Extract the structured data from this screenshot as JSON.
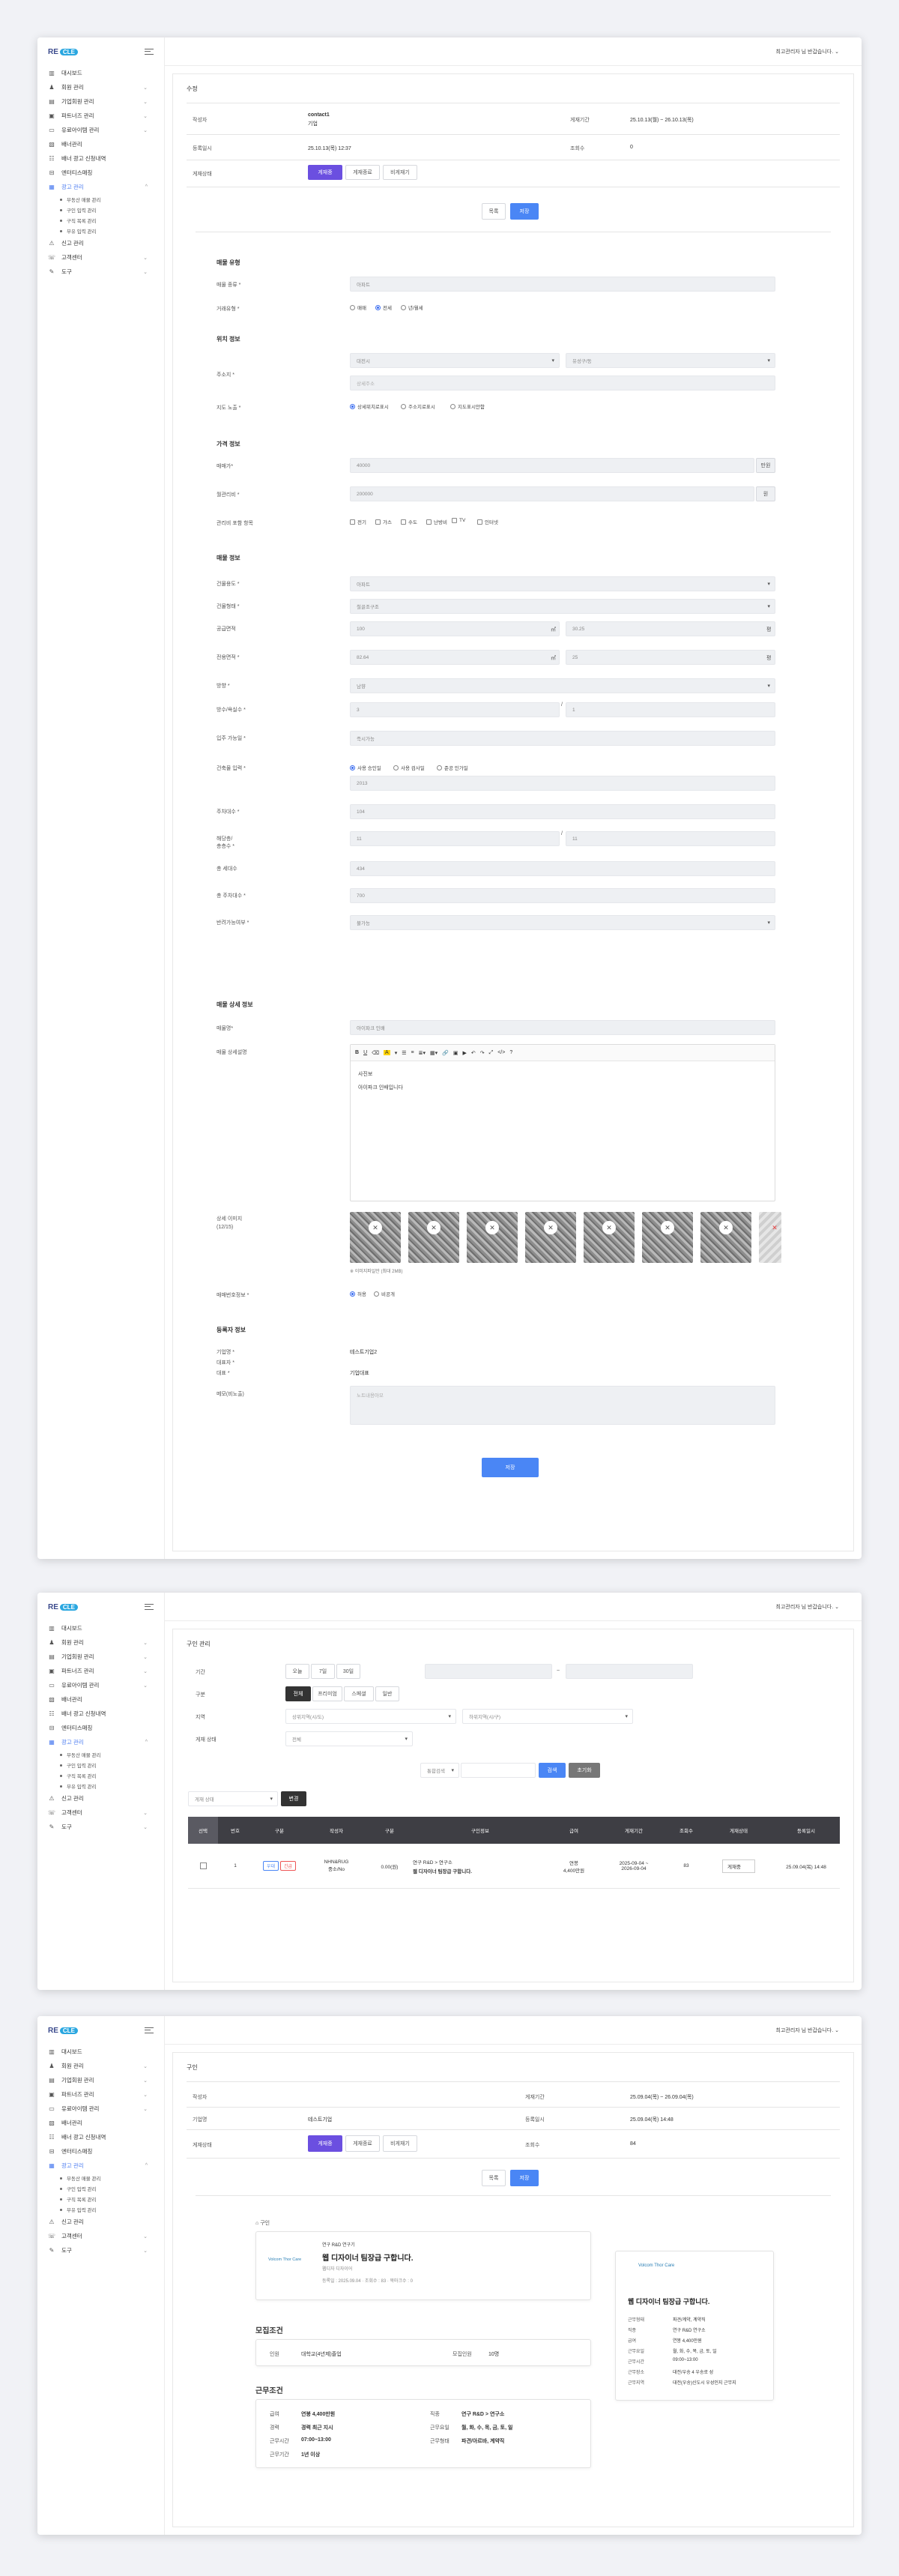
{
  "brand": {
    "logo_text": "RE",
    "logo_badge": "CLE"
  },
  "header": {
    "user_menu": "최고관리자 님 반갑습니다."
  },
  "sidebar": {
    "items": [
      {
        "label": "대시보드",
        "icon": "chart-icon"
      },
      {
        "label": "회원 관리",
        "icon": "user-icon",
        "caret": "⌄"
      },
      {
        "label": "기업회원 관리",
        "icon": "building-icon",
        "caret": "⌄"
      },
      {
        "label": "파트너즈 관리",
        "icon": "briefcase-icon",
        "caret": "⌄"
      },
      {
        "label": "유료아이템 관리",
        "icon": "card-icon",
        "caret": "⌄"
      },
      {
        "label": "배너관리",
        "icon": "image-icon"
      },
      {
        "label": "배너 광고 신청내역",
        "icon": "list-icon"
      },
      {
        "label": "엔터티스매칭",
        "icon": "link-icon"
      },
      {
        "label": "광고 관리",
        "icon": "doc-icon",
        "caret": "^",
        "active": true
      },
      {
        "label": "부동산 매물 관리",
        "sub": true
      },
      {
        "label": "구인 입력 관리",
        "sub": true
      },
      {
        "label": "구직 목록 관리",
        "sub": true
      },
      {
        "label": "부유 입력 관리",
        "sub": true
      },
      {
        "label": "신고 관리",
        "icon": "warning-icon"
      },
      {
        "label": "고객센터",
        "icon": "chat-icon",
        "caret": "⌄"
      },
      {
        "label": "도구",
        "icon": "tool-icon",
        "caret": "⌄"
      }
    ]
  },
  "panel1": {
    "page_title": "수정",
    "info": {
      "author_label": "작성자",
      "author_id": "contact1",
      "author_type": "기업",
      "period_label": "게재기간",
      "period": "25.10.13(월) ~ 26.10.13(목)",
      "reg_label": "등록일시",
      "reg": "25.10.13(목) 12:37",
      "views_label": "조회수",
      "views": "0",
      "status_label": "게재상태",
      "status_btns": [
        "게재중",
        "게재종료",
        "비게재기"
      ]
    },
    "top_btns": {
      "cancel": "목록",
      "save": "저장"
    },
    "s1": {
      "title": "매물 유형",
      "kind_label": "매물 종류 *",
      "kind_value": "아파트",
      "deal_label": "거래유형 *",
      "deal_opts": [
        "매매",
        "전세",
        "년/월세"
      ]
    },
    "s2": {
      "title": "위치 정보",
      "addr_label": "주소지 *",
      "city": "대전시",
      "district": "유성구/동",
      "addr_ph": "상세주소",
      "map_label": "지도 노출 *",
      "map_opts": [
        "상세위치로표시",
        "주소지로표시",
        "지도표시안함"
      ]
    },
    "s3": {
      "title": "가격 정보",
      "sale_label": "매매가*",
      "sale_value": "40000",
      "rent_label": "월관리비 *",
      "rent_value": "200000",
      "unit": "만원",
      "unit2": "원",
      "incl_label": "관리비 포함 항목",
      "incl_opts": [
        "전기",
        "가스",
        "수도",
        "난방비",
        "TV",
        "인터넷"
      ]
    },
    "s4": {
      "title": "매물 정보",
      "type_label": "건물용도 *",
      "type_value": "아파트",
      "struct_label": "건물형태 *",
      "struct_value": "철골조구조",
      "supply_label": "공급면적",
      "supply_value": "100",
      "supply_py": "30.25",
      "m2": "㎡",
      "py": "평",
      "excl_label": "전용면적 *",
      "excl_value": "82.64",
      "excl_py": "25",
      "dir_label": "방향 *",
      "dir_value": "남향",
      "room_label": "방수/욕실수 *",
      "room_value": "3",
      "bath_value": "1",
      "sep": "/",
      "move_label": "입주 가능일 *",
      "move_value": "즉시가능",
      "year_label": "건축물 입력 *",
      "year_opts": [
        "사용 승인일",
        "사용 검사일",
        "준공 인가일"
      ],
      "year_value": "2013",
      "parking_label": "주차대수 *",
      "parking_value": "104",
      "floor_label": "해당층/\n총층수 *",
      "floor_value": "11",
      "floor_total": "11",
      "units_label": "총 세대수",
      "units_value": "434",
      "elev_label": "총 주차대수 *",
      "elev_value": "700",
      "pet_label": "반려가능여부 *",
      "pet_value": "불가능"
    },
    "s5": {
      "title": "매물 상세 정보",
      "name_label": "매물명*",
      "name_value": "아이파크 인배",
      "desc_label": "매물 상세설명",
      "editor_lines": [
        "사진보",
        "아이파크 인배입니다"
      ],
      "photos_label": "상세 이미지\n(12/15)",
      "photo_hint": "※ 이미지파일만 (최대 2MB)",
      "dong_label": "매매번호정보 *",
      "dong_opts": [
        "허용",
        "비공개"
      ]
    },
    "s6": {
      "title": "등록자 정보",
      "company_label": "기업명 *",
      "company_value": "테스트기업2",
      "rep_label": "대표자 *",
      "rep_value": "",
      "tel_label": "대표 *",
      "tel_value": "기업대표",
      "memo_label": "메모(비노출)",
      "memo_ph": "노트내용아모"
    },
    "submit": "저장"
  },
  "panel2": {
    "page_title": "구인 관리",
    "period_label": "기간",
    "period_btns": [
      "오늘",
      "7일",
      "30일"
    ],
    "range_sep": "~",
    "type_label": "구분",
    "type_btns": [
      "전체",
      "프리미엄",
      "스페셜",
      "일반"
    ],
    "region_label": "지역",
    "region1": "상위지역(시/도)",
    "region2": "하위지역(시/구)",
    "status_label": "게재 상태",
    "status_value": "전체",
    "search_select": "통합검색",
    "search_btn": "검색",
    "reset_btn": "초기화",
    "bulk_select": "게재 상태",
    "bulk_btn": "변경",
    "cols": [
      "선택",
      "번호",
      "구분",
      "작성자",
      "구분",
      "구인정보",
      "급여",
      "게재기간",
      "조회수",
      "게재상태",
      "등록일시"
    ],
    "row": {
      "no": "1",
      "tags": [
        "우대",
        "긴급"
      ],
      "author": "NHN&RUG\n중소/No",
      "cat": "0.00(원)",
      "info1": "연구 R&D > 연구소",
      "info2": "웹 디자이너 팀장급 구합니다.",
      "pay": "연봉\n4,400만원",
      "period1": "2025-09-04 ~",
      "period2": "2026-09-04",
      "views": "83",
      "status": "게재중",
      "date": "25.09.04(목) 14:48"
    }
  },
  "panel3": {
    "page_title": "구인",
    "info": {
      "author_label": "작성자",
      "period_label": "게재기간",
      "period": "25.09.04(목) ~ 26.09.04(목)",
      "company_label": "기업명",
      "company": "테스트기업",
      "reg_label": "등록일시",
      "reg": "25.09.04(목) 14:48",
      "status_label": "게재상태",
      "views_label": "조회수",
      "views": "84",
      "status_btns": [
        "게재중",
        "게재종료",
        "비게재기"
      ]
    },
    "top_btns": {
      "cancel": "목록",
      "save": "저장"
    },
    "crumb": "구인",
    "card": {
      "company": "연구 R&D 연구기",
      "title": "웹 디자이너 팀장급 구합니다.",
      "sub": "웹디자 디자이어",
      "meta": "등록일 : 2025.09.04 · 조회수 : 83 · 북마크수 : 0",
      "logo": "Volcom Thor Care"
    },
    "cond": {
      "title": "모집조건",
      "f1_label": "인원",
      "f1_value": "대학교(4년제)졸업",
      "f2_label": "모집인원",
      "f2_value": "10명"
    },
    "work": {
      "title": "근무조건",
      "rows": [
        [
          "급여",
          "연봉 4,400만원",
          "직종",
          "연구 R&D > 연구소"
        ],
        [
          "경력",
          "경력 최근 지시",
          "근무요일",
          "월, 화, 수, 목, 금, 토, 일"
        ],
        [
          "근무시간",
          "07:00~13:00",
          "근무형태",
          "파견/아르바, 계약직"
        ],
        [
          "근무기간",
          "1년 이상",
          "",
          ""
        ]
      ]
    },
    "side": {
      "logo": "Volcom Thor Care",
      "title": "웹 디자이너 팀장급 구합니다.",
      "rows": [
        [
          "근무형태",
          "파견/계약, 계약직"
        ],
        [
          "직종",
          "연구 R&D 연구소"
        ],
        [
          "급여",
          "연봉 4,400만원"
        ],
        [
          "근무요일",
          "월, 화, 수, 목, 금, 토, 일"
        ],
        [
          "근무시간",
          "09:00~13:00"
        ],
        [
          "근무장소",
          "대전/우송 4 우송로 성"
        ],
        [
          "근무지역",
          "대전(우송)신도시 우성인지 근무지"
        ]
      ]
    }
  }
}
